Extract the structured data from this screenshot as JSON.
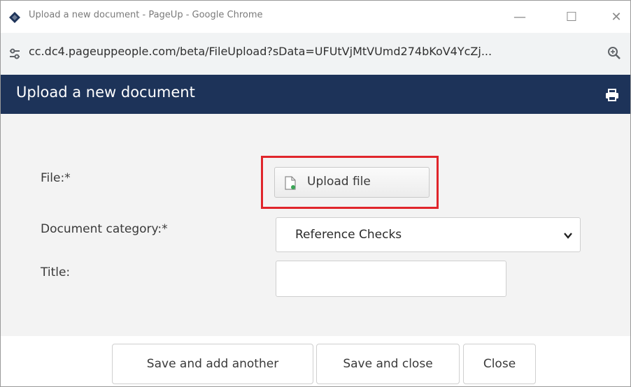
{
  "window": {
    "title": "Upload a new document - PageUp - Google Chrome",
    "minimize_glyph": "—",
    "maximize_glyph": "☐",
    "close_glyph": "✕"
  },
  "address_bar": {
    "url": "cc.dc4.pageuppeople.com/beta/FileUpload?sData=UFUtVjMtVUmd274bKoV4YcZj..."
  },
  "page": {
    "title": "Upload a new document",
    "header_color": "#1d3359"
  },
  "form": {
    "file_label": "File:*",
    "upload_button_label": "Upload file",
    "highlight_color": "#e0252b",
    "category_label": "Document category:*",
    "category_selected": "Reference Checks",
    "title_label": "Title:",
    "title_value": ""
  },
  "footer": {
    "save_and_add_another": "Save and add another",
    "save_and_close": "Save and close",
    "close": "Close"
  },
  "icons": {
    "app": "pageup-logo-icon",
    "site_info": "tune-icon",
    "zoom": "zoom-icon",
    "print": "print-icon",
    "upload": "file-upload-icon",
    "dropdown": "chevron-down-icon"
  }
}
